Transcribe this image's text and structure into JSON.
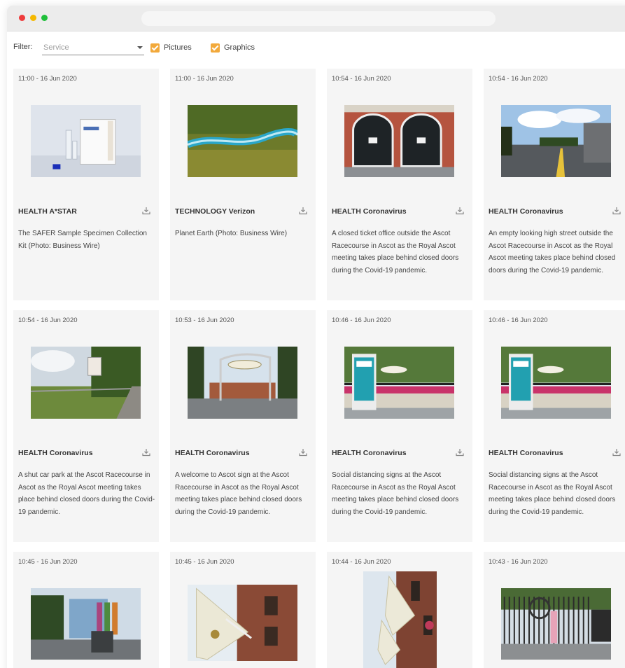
{
  "filter": {
    "label": "Filter:",
    "service_placeholder": "Service",
    "pictures_label": "Pictures",
    "graphics_label": "Graphics",
    "accent": "#f2a93b"
  },
  "cards": [
    {
      "time": "11:00 - 16 Jun 2020",
      "category": "HEALTH A*STAR",
      "description": "The SAFER Sample Specimen Collection Kit (Photo: Business Wire)",
      "image": "specimen-kit-photo"
    },
    {
      "time": "11:00 - 16 Jun 2020",
      "category": "TECHNOLOGY Verizon",
      "description": "Planet Earth (Photo: Business Wire)",
      "image": "river-aerial-photo"
    },
    {
      "time": "10:54 - 16 Jun 2020",
      "category": "HEALTH Coronavirus",
      "description": "A closed ticket office outside the Ascot Racecourse in Ascot as the Royal Ascot meeting takes place behind closed doors during the Covid-19 pandemic.",
      "image": "ticket-office-photo"
    },
    {
      "time": "10:54 - 16 Jun 2020",
      "category": "HEALTH Coronavirus",
      "description": "An empty looking high street outside the Ascot Racecourse in Ascot as the Royal Ascot meeting takes place behind closed doors during the Covid-19 pandemic.",
      "image": "high-street-photo"
    },
    {
      "time": "10:54 - 16 Jun 2020",
      "category": "HEALTH Coronavirus",
      "description": "A shut car park at the Ascot Racecourse in Ascot as the Royal Ascot meeting takes place behind closed doors during the Covid-19 pandemic.",
      "image": "car-park-photo"
    },
    {
      "time": "10:53 - 16 Jun 2020",
      "category": "HEALTH Coronavirus",
      "description": "A welcome to Ascot sign at the Ascot Racecourse in Ascot as the Royal Ascot meeting takes place behind closed doors during the Covid-19 pandemic.",
      "image": "welcome-sign-photo"
    },
    {
      "time": "10:46 - 16 Jun 2020",
      "category": "HEALTH Coronavirus",
      "description": "Social distancing signs at the Ascot Racecourse in Ascot as the Royal Ascot meeting takes place behind closed doors during the Covid-19 pandemic.",
      "image": "distancing-sign-photo"
    },
    {
      "time": "10:46 - 16 Jun 2020",
      "category": "HEALTH Coronavirus",
      "description": "Social distancing signs at the Ascot Racecourse in Ascot as the Royal Ascot meeting takes place behind closed doors during the Covid-19 pandemic.",
      "image": "distancing-sign-photo"
    },
    {
      "time": "10:45 - 16 Jun 2020",
      "category": "",
      "description": "",
      "image": "gate-flags-photo"
    },
    {
      "time": "10:45 - 16 Jun 2020",
      "category": "",
      "description": "",
      "image": "royal-ascot-flag-photo"
    },
    {
      "time": "10:44 - 16 Jun 2020",
      "category": "",
      "description": "",
      "image": "royal-ascot-flags-building-photo"
    },
    {
      "time": "10:43 - 16 Jun 2020",
      "category": "",
      "description": "",
      "image": "closed-gates-photo"
    }
  ]
}
